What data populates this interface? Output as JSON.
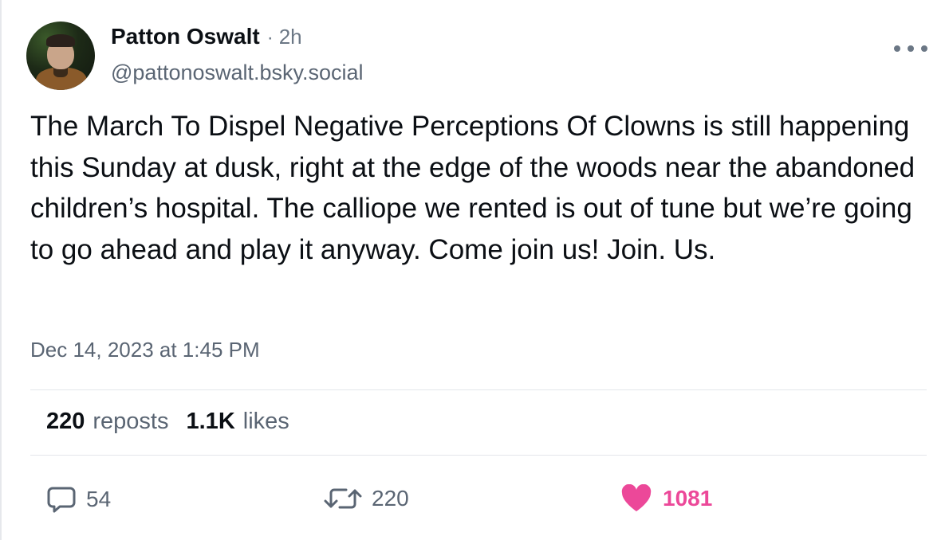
{
  "author": {
    "display_name": "Patton Oswalt",
    "separator": "·",
    "time_ago": "2h",
    "handle": "@pattonoswalt.bsky.social",
    "avatar_icon": "profile-photo"
  },
  "post": {
    "text": "The March To Dispel Negative Perceptions Of Clowns is still happening this Sunday at dusk, right at the edge of the woods near the abandoned children’s hospital. The calliope we rented is out of tune but we’re going to go ahead and play it anyway. Come join us! Join. Us.",
    "timestamp": "Dec 14, 2023 at 1:45 PM"
  },
  "stats": {
    "reposts_count": "220",
    "reposts_label": "reposts",
    "likes_count": "1.1K",
    "likes_label": "likes"
  },
  "actions": {
    "reply_count": "54",
    "repost_count": "220",
    "like_count": "1081",
    "reply_icon": "speech-bubble",
    "repost_icon": "repost-arrows",
    "like_icon": "heart",
    "like_color": "#ec4899",
    "more_icon": "ellipsis"
  },
  "colors": {
    "text_primary": "#0b0f14",
    "text_secondary": "#5a6573",
    "like_active": "#ec4899"
  }
}
